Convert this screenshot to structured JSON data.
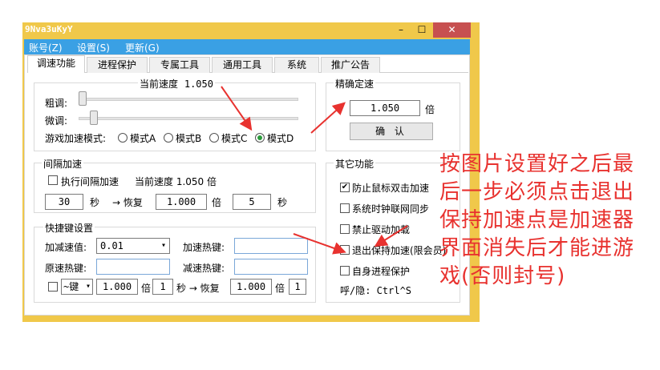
{
  "window": {
    "title": "9Nva3uKyY",
    "minimize_label": "–",
    "maximize_label": "☐",
    "close_label": "✕"
  },
  "menu": [
    "账号(Z)",
    "设置(S)",
    "更新(G)"
  ],
  "tabs": [
    "调速功能",
    "进程保护",
    "专属工具",
    "通用工具",
    "系统",
    "推广公告"
  ],
  "speed": {
    "current_label": "当前速度",
    "current_value": "1.050",
    "coarse_label": "粗调:",
    "fine_label": "微调:",
    "coarse_level": 0,
    "fine_level": 0.03,
    "mode_label": "游戏加速模式:",
    "modes": [
      "模式A",
      "模式B",
      "模式C",
      "模式D"
    ],
    "selected_mode": "模式D"
  },
  "precise": {
    "title": "精确定速",
    "value": "1.050",
    "unit": "倍",
    "confirm_label": "确 认"
  },
  "interval": {
    "title": "间隔加速",
    "checkbox_label": "执行间隔加速",
    "current_label": "当前速度 1.050 倍",
    "seconds_value": "30",
    "seconds_unit": "秒",
    "arrow_label": "→ 恢复",
    "restore_value": "1.000",
    "restore_unit": "倍",
    "restore_seconds": "5",
    "restore_seconds_unit": "秒"
  },
  "hotkeys": {
    "title": "快捷键设置",
    "step_label": "加减速值:",
    "step_value": "0.01",
    "speedup_label": "加速热键:",
    "reset_label": "原速热键:",
    "slowdown_label": "减速热键:",
    "combo_select": "~键",
    "combo_value": "1.000",
    "combo_unit": "倍",
    "combo_seconds": "1",
    "combo_arrow": "秒 → 恢复",
    "combo_restore_value": "1.000",
    "combo_restore_unit": "倍",
    "combo_restore_seconds": "1"
  },
  "other": {
    "title": "其它功能",
    "items": [
      {
        "label": "防止鼠标双击加速",
        "checked": true
      },
      {
        "label": "系统时钟联网同步",
        "checked": false
      },
      {
        "label": "禁止驱动加载",
        "checked": false
      },
      {
        "label": "退出保持加速(限会员)",
        "checked": false
      },
      {
        "label": "自身进程保护",
        "checked": false
      }
    ],
    "hotkey_label": "呼/隐: Ctrl^S"
  },
  "annotation": {
    "text": "按图片设置好之后最后一步必须点击退出保持加速点是加速器界面消失后才能进游戏(否则封号)",
    "color": "#e8322f"
  }
}
